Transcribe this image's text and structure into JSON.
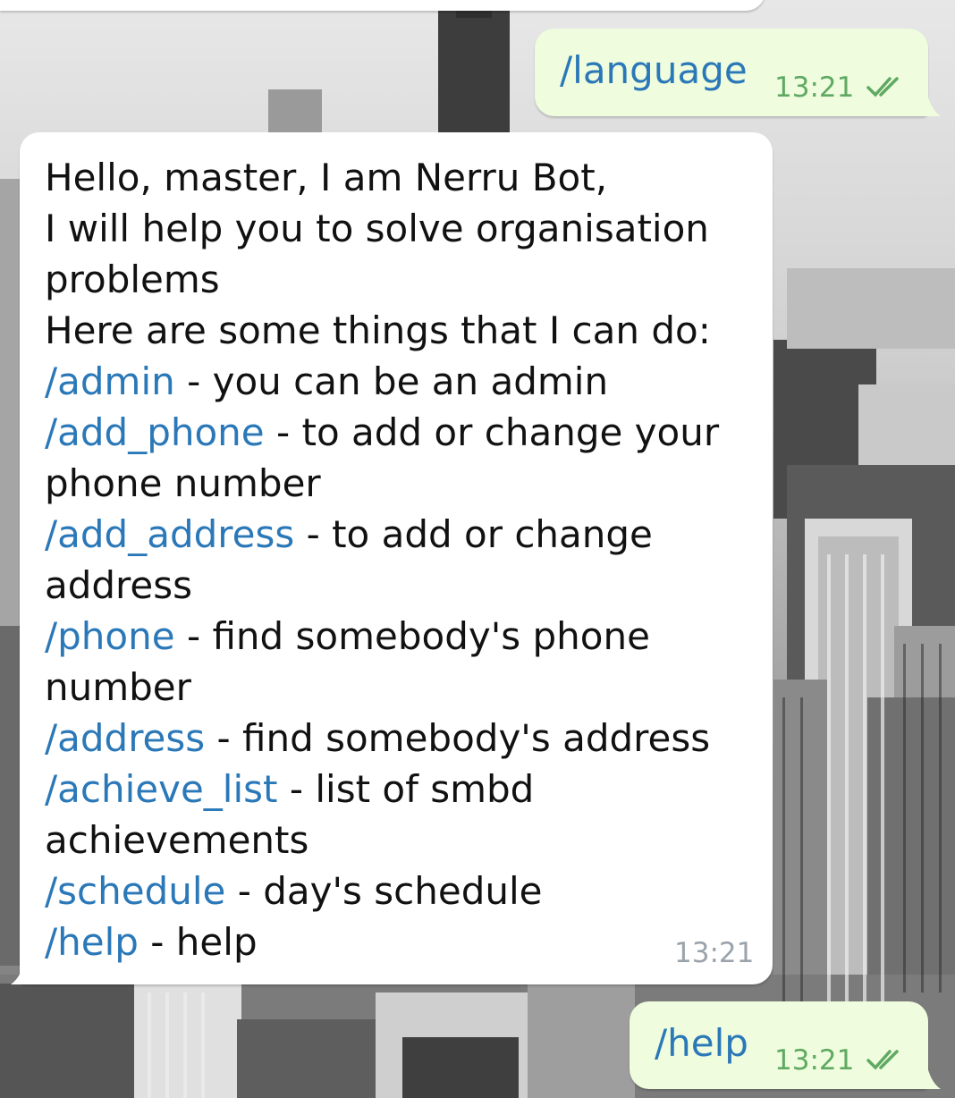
{
  "messages": {
    "out_language": {
      "text": "/language",
      "time": "13:21",
      "status_icon": "double-check-icon"
    },
    "bot_reply": {
      "lines": [
        {
          "text": "Hello, master, I am Nerru Bot,"
        },
        {
          "text": "I will help you to solve organisation"
        },
        {
          "text": "problems"
        },
        {
          "text": "Here are some things that I can do:"
        },
        {
          "link": "/admin",
          "text": " - you can be an admin"
        },
        {
          "link": "/add_phone",
          "text": " - to add or change your"
        },
        {
          "text": "phone number"
        },
        {
          "link": "/add_address",
          "text": " - to add or change"
        },
        {
          "text": "address"
        },
        {
          "link": "/phone",
          "text": " - find somebody's phone"
        },
        {
          "text": "number"
        },
        {
          "link": "/address",
          "text": " - find somebody's address"
        },
        {
          "link": "/achieve_list",
          "text": " - list of smbd"
        },
        {
          "text": "achievements"
        },
        {
          "link": "/schedule",
          "text": " - day's schedule"
        },
        {
          "link": "/help",
          "text": " - help"
        }
      ],
      "time": "13:21"
    },
    "out_help": {
      "text": "/help",
      "time": "13:21",
      "status_icon": "double-check-icon"
    }
  },
  "colors": {
    "outgoing_bubble": "#effdde",
    "incoming_bubble": "#ffffff",
    "link": "#2b78b8",
    "outgoing_time": "#5fa962",
    "incoming_time": "#9aa3ab"
  }
}
